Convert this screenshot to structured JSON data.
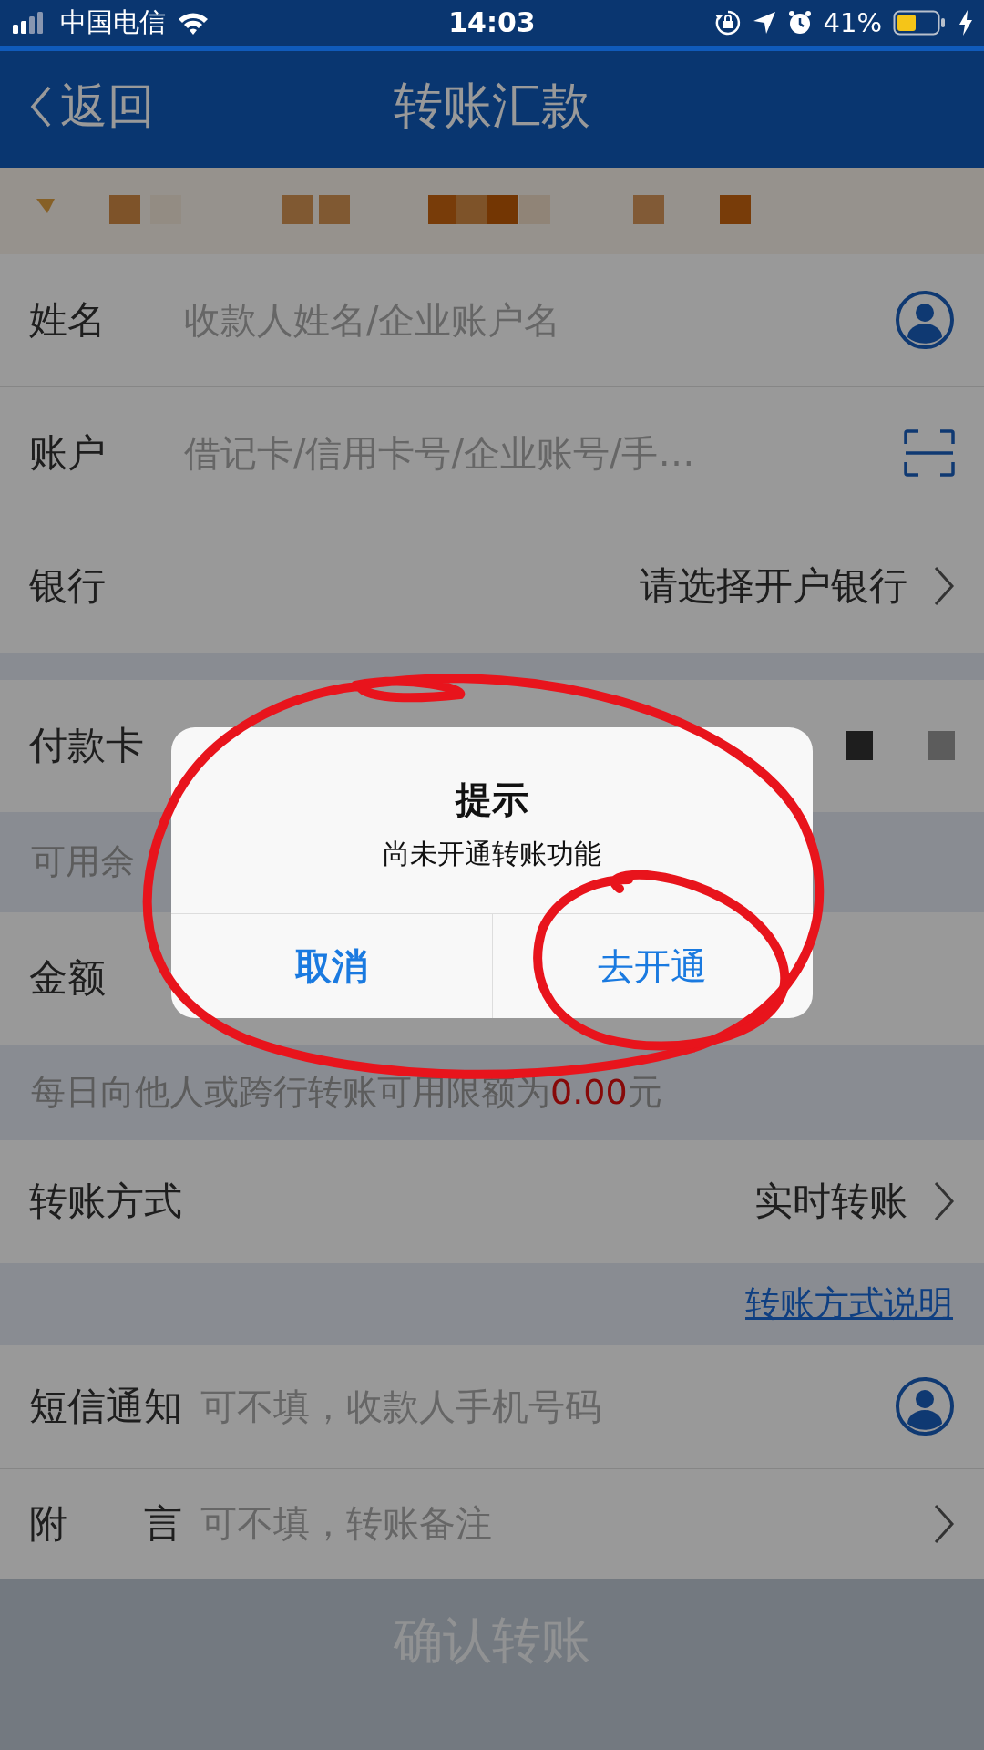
{
  "status_bar": {
    "carrier": "中国电信",
    "time": "14:03",
    "battery": "41%"
  },
  "nav": {
    "back": "返回",
    "title": "转账汇款"
  },
  "form": [
    {
      "kind": "group",
      "rows": [
        {
          "kind": "contact",
          "label": "姓名",
          "placeholder": "收款人姓名/企业账户名"
        },
        {
          "kind": "scan",
          "label": "账户",
          "placeholder": "借记卡/信用卡号/企业账号/手…"
        },
        {
          "kind": "select",
          "label": "银行",
          "value": "请选择开户银行"
        }
      ]
    },
    {
      "kind": "group",
      "rows": [
        {
          "kind": "plain",
          "label": "付款卡",
          "redacted": true
        }
      ]
    },
    {
      "kind": "note",
      "text": "可用余"
    },
    {
      "kind": "group",
      "rows": [
        {
          "kind": "plain",
          "label": "金额"
        }
      ]
    },
    {
      "kind": "limit_note",
      "prefix": "每日向他人或跨行转账可用限额为",
      "amount": "0.00",
      "suffix": "元"
    },
    {
      "kind": "group",
      "rows": [
        {
          "kind": "select",
          "label": "转账方式",
          "value": "实时转账"
        }
      ]
    },
    {
      "kind": "link",
      "text": "转账方式说明"
    },
    {
      "kind": "group",
      "rows": [
        {
          "kind": "contact",
          "label": "短信通知",
          "placeholder": "可不填，收款人手机号码"
        },
        {
          "kind": "select",
          "label": "附　　言",
          "placeholder": "可不填，转账备注"
        }
      ]
    }
  ],
  "submit": {
    "label": "确认转账",
    "disabled": true
  },
  "dialog": {
    "title": "提示",
    "message": "尚未开通转账功能",
    "buttons": [
      {
        "label": "取消",
        "bold": true
      },
      {
        "label": "去开通",
        "bold": false
      }
    ]
  }
}
